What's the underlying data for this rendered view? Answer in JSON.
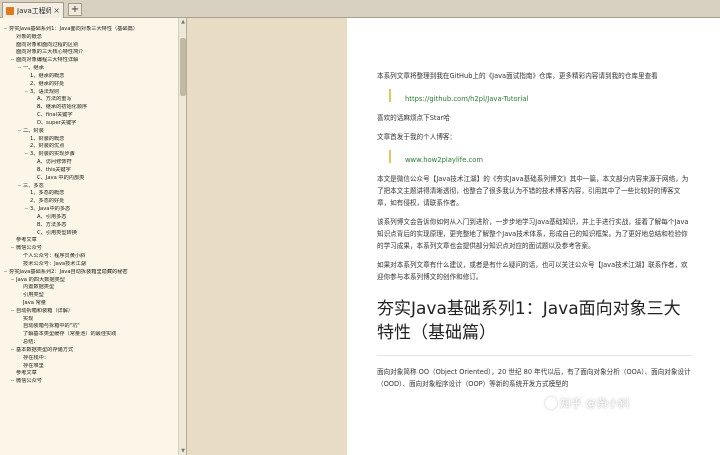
{
  "tab": {
    "icon": "document-icon",
    "title": "Java工程师…",
    "close": "×",
    "new_tab": "+"
  },
  "sidebar": {
    "scroll_up": "▲",
    "scroll_down": "▼",
    "items": [
      {
        "t": "夯实Java基础系列1：Java面向对象三大特性（基础篇）",
        "i": 0,
        "g": "−"
      },
      {
        "t": "对象的概念",
        "i": 1,
        "g": ""
      },
      {
        "t": "面向对象和面向过程的区别",
        "i": 1,
        "g": ""
      },
      {
        "t": "面向对象的三大核心特性简介",
        "i": 1,
        "g": ""
      },
      {
        "t": "面向对象编程三大特性详解",
        "i": 1,
        "g": "−"
      },
      {
        "t": "一、继承",
        "i": 2,
        "g": "−"
      },
      {
        "t": "1、继承的概念",
        "i": 3,
        "g": ""
      },
      {
        "t": "2、继承的好处",
        "i": 3,
        "g": ""
      },
      {
        "t": "3、语法规则",
        "i": 3,
        "g": "−"
      },
      {
        "t": "A、方法的重写",
        "i": 4,
        "g": ""
      },
      {
        "t": "B、继承的初始化顺序",
        "i": 4,
        "g": ""
      },
      {
        "t": "C、final关键字",
        "i": 4,
        "g": ""
      },
      {
        "t": "D、super关键字",
        "i": 4,
        "g": ""
      },
      {
        "t": "二、封装",
        "i": 2,
        "g": "−"
      },
      {
        "t": "1、封装的概念",
        "i": 3,
        "g": ""
      },
      {
        "t": "2、封装的优点",
        "i": 3,
        "g": ""
      },
      {
        "t": "3、封装的实现步骤",
        "i": 3,
        "g": "−"
      },
      {
        "t": "A、访问修饰符",
        "i": 4,
        "g": ""
      },
      {
        "t": "B、this关键字",
        "i": 4,
        "g": ""
      },
      {
        "t": "C、Java 中的内部类",
        "i": 4,
        "g": ""
      },
      {
        "t": "三、多态",
        "i": 2,
        "g": "−"
      },
      {
        "t": "1、多态的概念",
        "i": 3,
        "g": ""
      },
      {
        "t": "2、多态的好处",
        "i": 3,
        "g": ""
      },
      {
        "t": "3、Java中的多态",
        "i": 3,
        "g": "−"
      },
      {
        "t": "A、引用多态",
        "i": 4,
        "g": ""
      },
      {
        "t": "B、方法多态",
        "i": 4,
        "g": ""
      },
      {
        "t": "C、引用类型转换",
        "i": 4,
        "g": ""
      },
      {
        "t": "参考文章",
        "i": 1,
        "g": ""
      },
      {
        "t": "微信公众号",
        "i": 1,
        "g": "−"
      },
      {
        "t": "个人公众号：程序员黄小斜",
        "i": 2,
        "g": ""
      },
      {
        "t": "技术公众号：Java技术江湖",
        "i": 2,
        "g": ""
      },
      {
        "t": "夯实Java基础系列2：Java自动拆装箱里隐藏的秘密",
        "i": 0,
        "g": "−"
      },
      {
        "t": "Java 的四大数据类型",
        "i": 1,
        "g": "−"
      },
      {
        "t": "内置数据类型",
        "i": 2,
        "g": ""
      },
      {
        "t": "引用类型",
        "i": 2,
        "g": ""
      },
      {
        "t": "Java 常量",
        "i": 2,
        "g": ""
      },
      {
        "t": "自动拆箱和装箱（详解）",
        "i": 1,
        "g": "−"
      },
      {
        "t": "实现",
        "i": 2,
        "g": ""
      },
      {
        "t": "自动装箱与拆箱中的\"坑\"",
        "i": 2,
        "g": ""
      },
      {
        "t": "了解基本类型缓存（常量池）的最佳实践",
        "i": 2,
        "g": ""
      },
      {
        "t": "总结：",
        "i": 2,
        "g": ""
      },
      {
        "t": "基本数据类型的存储方式",
        "i": 1,
        "g": "−"
      },
      {
        "t": "存在栈中：",
        "i": 2,
        "g": ""
      },
      {
        "t": "存在堆里",
        "i": 2,
        "g": ""
      },
      {
        "t": "参考文章",
        "i": 1,
        "g": ""
      },
      {
        "t": "微信公众号",
        "i": 1,
        "g": "−"
      }
    ]
  },
  "content": {
    "intro": "本系列文章将整理到我在GitHub上的《Java面试指南》仓库，更多精彩内容请到我的仓库里查看",
    "repo_link": "https://github.com/h2pl/Java-Tutorial",
    "star_text": "喜欢的话麻烦点下Star哈",
    "blog_text": "文章首发于我的个人博客：",
    "blog_link": "www.how2playlife.com",
    "para1": "本文是微信公众号【Java技术江湖】的《夯实Java基础系列博文》其中一篇，本文部分内容来源于网络，为了把本文主题讲得清晰透彻，也整合了很多我认为不错的技术博客内容，引用其中了一些比较好的博客文章，如有侵权，请联系作者。",
    "para2": "该系列博文会告诉你如何从入门到进阶，一步步地学习Java基础知识，并上手进行实战，接着了解每个Java知识点背后的实现原理，更完整地了解整个Java技术体系，形成自己的知识框架。为了更好地总结和检验你的学习成果，本系列文章也会提供部分知识点对应的面试题以及参考答案。",
    "para3": "如果对本系列文章有什么建议，或者是有什么疑问的话，也可以关注公众号【Java技术江湖】联系作者，欢迎你参与本系列博文的创作和修订。",
    "heading": "夯实Java基础系列1：Java面向对象三大特性（基础篇）",
    "para4": "面向对象简称 OO（Object Oriented），20 世纪 80 年代以后，有了面向对象分析（OOA）、面向对象设计（OOD）、面向对象程序设计（OOP）等新的系统开发方式模型的"
  },
  "watermark": {
    "icon": "zhihu-logo-icon",
    "text": "知乎 @黄小斜"
  },
  "colors": {
    "toolbar": "#d8d0c0",
    "sidebar": "#fbf6e8",
    "page_bg": "#e8dcc4",
    "link": "#2a7d2e",
    "quote_bar": "#e4c65a"
  }
}
